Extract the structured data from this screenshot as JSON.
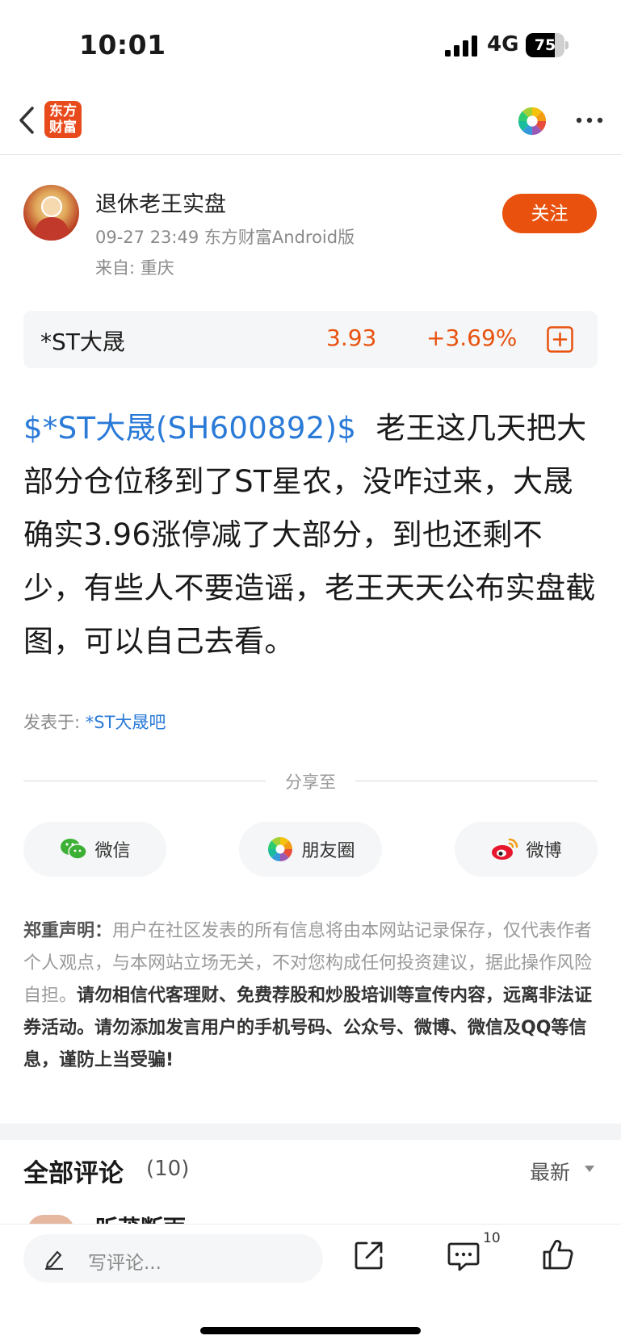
{
  "status_bar": {
    "time": "10:01",
    "network": "4G",
    "battery_percent": "75",
    "battery_level": 0.75
  },
  "nav": {
    "logo_line1": "东方",
    "logo_line2": "财富"
  },
  "author": {
    "name": "退休老王实盘",
    "meta": "09-27 23:49 东方财富Android版",
    "location": "来自: 重庆",
    "follow_label": "关注"
  },
  "stock": {
    "name": "*ST大晟",
    "price": "3.93",
    "change": "+3.69%",
    "up_color": "#e8520e"
  },
  "post": {
    "stock_tag": "$*ST大晟(SH600892)$",
    "text": "老王这几天把大部分仓位移到了ST星农，没咋过来，大晟确实3.96涨停减了大部分，到也还剩不少，有些人不要造谣，老王天天公布实盘截图，可以自己去看。",
    "posted_in_label": "发表于: ",
    "posted_in_link": "*ST大晟吧"
  },
  "share": {
    "title": "分享至",
    "buttons": [
      {
        "label": "微信",
        "icon": "wechat-icon"
      },
      {
        "label": "朋友圈",
        "icon": "moments-icon"
      },
      {
        "label": "微博",
        "icon": "weibo-icon"
      }
    ]
  },
  "disclaimer": {
    "heading": "郑重声明：",
    "normal": "用户在社区发表的所有信息将由本网站记录保存，仅代表作者个人观点，与本网站立场无关，不对您构成任何投资建议，据此操作风险自担。",
    "bold": "请勿相信代客理财、免费荐股和炒股培训等宣传内容，远离非法证券活动。请勿添加发言用户的手机号码、公众号、微博、微信及QQ等信息，谨防上当受骗!"
  },
  "comments": {
    "title": "全部评论",
    "count": "(10)",
    "sort_label": "最新",
    "first_commenter_partial": "昕茂断雨"
  },
  "bottom_bar": {
    "comment_placeholder": "写评论...",
    "message_count": "10"
  },
  "colors": {
    "brand_orange": "#e8520e",
    "link_blue": "#2a7ad8"
  }
}
